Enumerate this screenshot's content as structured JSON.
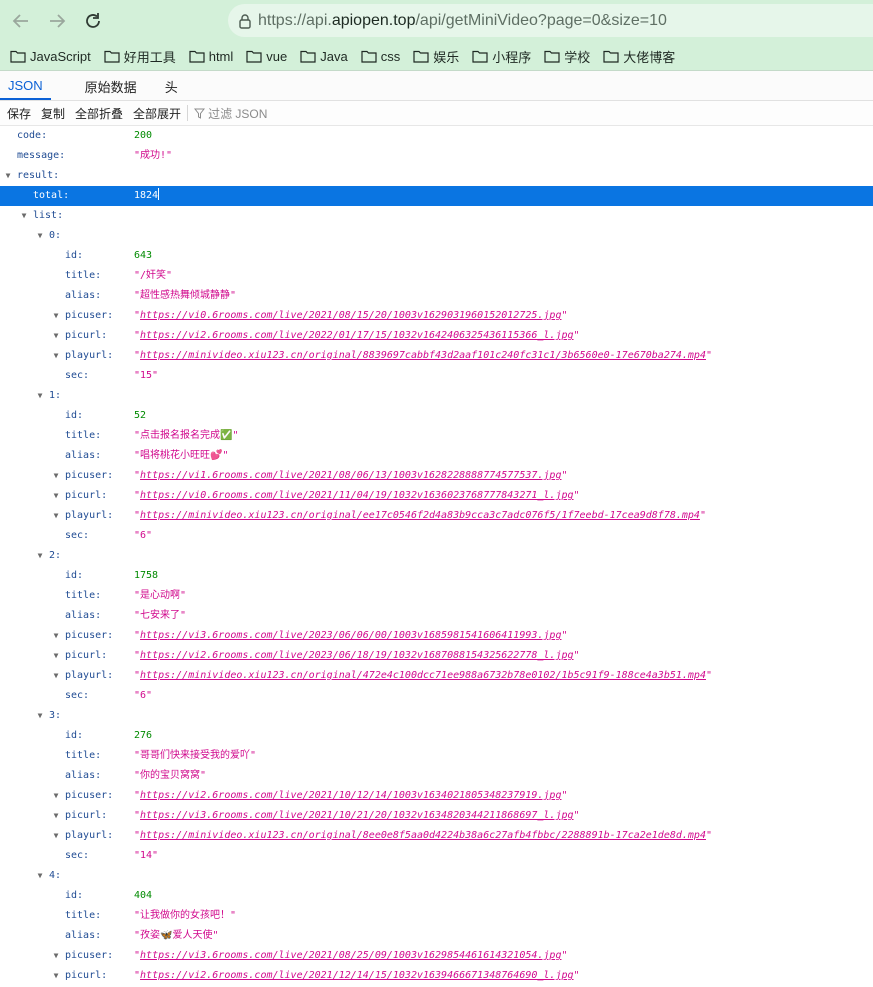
{
  "browser": {
    "url_prefix": "https://api.",
    "url_host": "apiopen.top",
    "url_path": "/api/getMiniVideo?page=0&size=10",
    "bookmarks": [
      "JavaScript",
      "好用工具",
      "html",
      "vue",
      "Java",
      "css",
      "娱乐",
      "小程序",
      "学校",
      "大佬博客"
    ]
  },
  "viewer": {
    "tabs": [
      "JSON",
      "原始数据",
      "头"
    ],
    "toolbar": {
      "save": "保存",
      "copy": "复制",
      "collapse_all": "全部折叠",
      "expand_all": "全部展开",
      "filter_placeholder": "过滤 JSON"
    }
  },
  "json": {
    "code": {
      "key": "code:",
      "value": "200"
    },
    "message": {
      "key": "message:",
      "value": "\"成功!\""
    },
    "result_key": "result:",
    "total": {
      "key": "total:",
      "value": "1824"
    },
    "list_key": "list:",
    "field_keys": {
      "id": "id:",
      "title": "title:",
      "alias": "alias:",
      "picuser": "picuser:",
      "picurl": "picurl:",
      "playurl": "playurl:",
      "sec": "sec:"
    },
    "items": [
      {
        "index": "0:",
        "id": "643",
        "title": "\"/奸笑\"",
        "alias": "\"超性感热舞倾城静静\"",
        "picuser": "https://vi0.6rooms.com/live/2021/08/15/20/1003v1629031960152012725.jpg",
        "picurl": "https://vi2.6rooms.com/live/2022/01/17/15/1032v1642406325436115366_l.jpg",
        "playurl": "https://minivideo.xiu123.cn/original/8839697cabbf43d2aaf101c240fc31c1/3b6560e0-17e670ba274.mp4",
        "sec": "\"15\""
      },
      {
        "index": "1:",
        "id": "52",
        "title": "\"点击报名报名完成✅\"",
        "alias": "\"唱将桃花小旺旺💕\"",
        "picuser": "https://vi1.6rooms.com/live/2021/08/06/13/1003v1628228888774577537.jpg",
        "picurl": "https://vi0.6rooms.com/live/2021/11/04/19/1032v1636023768777843271_l.jpg",
        "playurl": "https://minivideo.xiu123.cn/original/ee17c0546f2d4a83b9cca3c7adc076f5/1f7eebd-17cea9d8f78.mp4",
        "sec": "\"6\""
      },
      {
        "index": "2:",
        "id": "1758",
        "title": "\"是心动啊\"",
        "alias": "\"七安来了\"",
        "picuser": "https://vi3.6rooms.com/live/2023/06/06/00/1003v1685981541606411993.jpg",
        "picurl": "https://vi2.6rooms.com/live/2023/06/18/19/1032v1687088154325622778_l.jpg",
        "playurl": "https://minivideo.xiu123.cn/original/472e4c100dcc71ee988a6732b78e0102/1b5c91f9-188ce4a3b51.mp4",
        "sec": "\"6\""
      },
      {
        "index": "3:",
        "id": "276",
        "title": "\"哥哥们快来接受我的爱吖\"",
        "alias": "\"你的宝贝窝窝\"",
        "picuser": "https://vi2.6rooms.com/live/2021/10/12/14/1003v1634021805348237919.jpg",
        "picurl": "https://vi3.6rooms.com/live/2021/10/21/20/1032v1634820344211868697_l.jpg",
        "playurl": "https://minivideo.xiu123.cn/original/8ee0e8f5aa0d4224b38a6c27afb4fbbc/2288891b-17ca2e1de8d.mp4",
        "sec": "\"14\""
      },
      {
        "index": "4:",
        "id": "404",
        "title": "\"让我做你的女孩吧！\"",
        "alias": "\"孜姿🦋爱人天使\"",
        "picuser": "https://vi3.6rooms.com/live/2021/08/25/09/1003v1629854461614321054.jpg",
        "picurl": "https://vi2.6rooms.com/live/2021/12/14/15/1032v1639466671348764690_l.jpg"
      }
    ]
  }
}
